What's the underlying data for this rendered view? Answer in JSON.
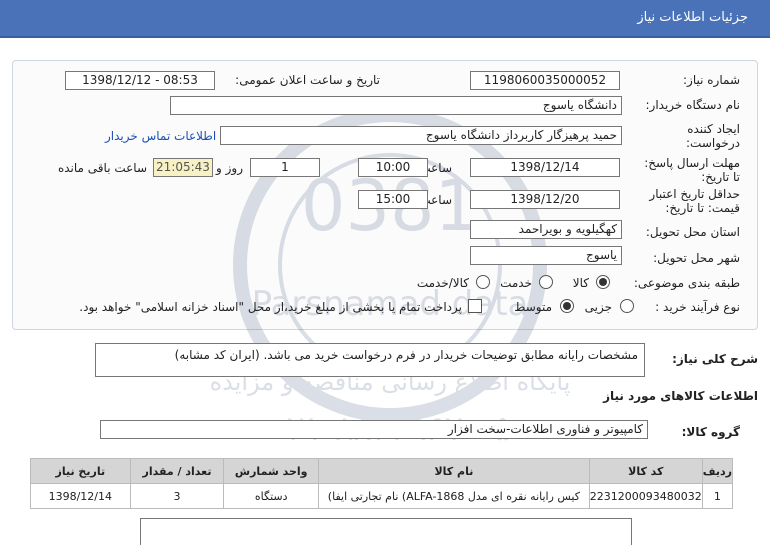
{
  "header": {
    "title": "جزئیات اطلاعات نیاز"
  },
  "form": {
    "need_number_label": "شماره نیاز:",
    "need_number": "1198060035000052",
    "announce_label": "تاریخ و ساعت اعلان عمومی:",
    "announce_value": "1398/12/12 - 08:53",
    "buyer_org_label": "نام دستگاه خریدار:",
    "buyer_org": "دانشگاه یاسوج",
    "creator_label_1": "ایجاد کننده",
    "creator_label_2": "درخواست:",
    "creator": "حمید پرهیزگار کاربرداز دانشگاه یاسوج",
    "contact_link": "اطلاعات تماس خریدار",
    "deadline_label_1": "مهلت ارسال پاسخ:",
    "deadline_label_2": "تا تاریخ:",
    "deadline_date": "1398/12/14",
    "time_label": "ساعت",
    "deadline_time": "10:00",
    "days_count": "1",
    "day_and_label": "روز و",
    "remaining_time": "21:05:43",
    "remaining_label": "ساعت باقی مانده",
    "validity_label_1": "حداقل تاریخ اعتبار",
    "validity_label_2": "قیمت: تا تاریخ:",
    "validity_date": "1398/12/20",
    "validity_time": "15:00",
    "province_label": "استان محل تحویل:",
    "province": "کهگیلویه و بویراحمد",
    "city_label": "شهر محل تحویل:",
    "city": "یاسوج",
    "category_label": "طبقه بندی موضوعی:",
    "category_options": [
      "کالا",
      "خدمت",
      "کالا/خدمت"
    ],
    "process_label": "نوع فرآیند خرید :",
    "process_options": [
      "جزیی",
      "متوسط"
    ],
    "payment_note": "پرداخت تمام یا بخشی از مبلغ خرید،از محل \"اسناد خزانه اسلامی\" خواهد بود."
  },
  "description": {
    "label": "شرح کلی نیاز:",
    "text": "مشخصات رایانه مطابق توضیحات خریدار در فرم درخواست خرید می باشد. (ایران کد مشابه)"
  },
  "goods": {
    "section_title": "اطلاعات کالاهای مورد نیاز",
    "group_label": "گروه کالا:",
    "group_value": "کامپیوتر و فناوری اطلاعات-سخت افزار",
    "columns": [
      "ردیف",
      "کد کالا",
      "نام کالا",
      "واحد شمارش",
      "تعداد / مقدار",
      "تاریخ نیاز"
    ],
    "rows": [
      [
        "1",
        "2231200093480032",
        "کیس رایانه نقره ای مدل ALFA-1868) نام تجارتی ایفا)",
        "دستگاه",
        "3",
        "1398/12/14"
      ]
    ]
  },
  "watermark": {
    "line1": "پایگاه اطلاع رسانی مناقصه و مزایده",
    "line2": "۰۲۱-۸۸۳۴۹۶۷۰-۵",
    "line3": "Parsnamad data"
  }
}
